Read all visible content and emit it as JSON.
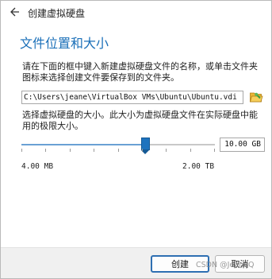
{
  "window": {
    "title": "创建虚拟硬盘",
    "back_icon": "back-arrow-icon"
  },
  "page": {
    "heading": "文件位置和大小",
    "location_description": "请在下面的框中键入新建虚拟硬盘文件的名称，或单击文件夹图标来选择创建文件要保存到的文件夹。",
    "file_path": "C:\\Users\\jeane\\VirtualBox VMs\\Ubuntu\\Ubuntu.vdi",
    "folder_icon": "folder-open-icon",
    "size_description": "选择虚拟硬盘的大小。此大小为虚拟硬盘文件在实际硬盘中能用的极限大小。",
    "size_value": "10.00 GB",
    "size_min_label": "4.00 MB",
    "size_max_label": "2.00 TB",
    "slider_position": 0.64,
    "slider_tick_count": 8
  },
  "buttons": {
    "create": "创建",
    "cancel": "取消"
  },
  "watermark": "CSDN @JeaneQ",
  "colors": {
    "accent": "#1e73be",
    "heading": "#1a6fb8"
  }
}
